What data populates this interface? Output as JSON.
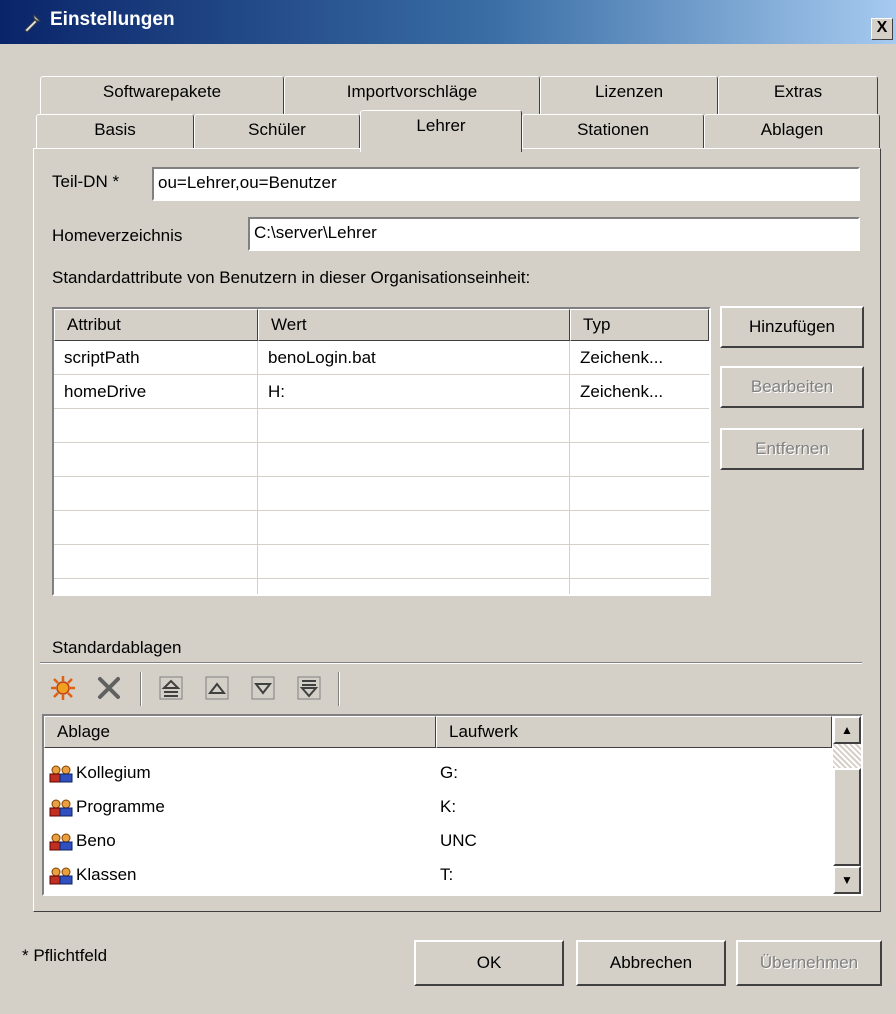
{
  "window": {
    "title": "Einstellungen",
    "close": "X"
  },
  "tabs_back": [
    "Softwarepakete",
    "Importvorschläge",
    "Lizenzen",
    "Extras"
  ],
  "tabs_front": [
    "Basis",
    "Schüler",
    "Lehrer",
    "Stationen",
    "Ablagen"
  ],
  "active_tab": "Lehrer",
  "form": {
    "teil_dn_label": "Teil-DN *",
    "teil_dn_value": "ou=Lehrer,ou=Benutzer",
    "home_label": "Homeverzeichnis",
    "home_value": "C:\\server\\Lehrer",
    "std_attr_label": "Standardattribute von Benutzern in dieser Organisationseinheit:"
  },
  "attr_table": {
    "columns": [
      "Attribut",
      "Wert",
      "Typ"
    ],
    "rows": [
      [
        "scriptPath",
        "benoLogin.bat",
        "Zeichenk..."
      ],
      [
        "homeDrive",
        "H:",
        "Zeichenk..."
      ]
    ]
  },
  "attr_buttons": {
    "add": "Hinzufügen",
    "edit": "Bearbeiten",
    "remove": "Entfernen"
  },
  "ablagen": {
    "section_label": "Standardablagen",
    "columns": [
      "Ablage",
      "Laufwerk"
    ],
    "rows": [
      [
        "Kollegium",
        "G:"
      ],
      [
        "Programme",
        "K:"
      ],
      [
        "Beno",
        "UNC"
      ],
      [
        "Klassen",
        "T:"
      ]
    ],
    "toolbar_icons": [
      "new-icon",
      "delete-icon",
      "move-top-icon",
      "move-up-icon",
      "move-down-icon",
      "move-bottom-icon"
    ]
  },
  "footer": {
    "required_note": "* Pflichtfeld",
    "ok": "OK",
    "cancel": "Abbrechen",
    "apply": "Übernehmen"
  },
  "colors": {
    "title_start": "#0a246a",
    "title_end": "#a6caf0",
    "face": "#d4d0c8"
  }
}
